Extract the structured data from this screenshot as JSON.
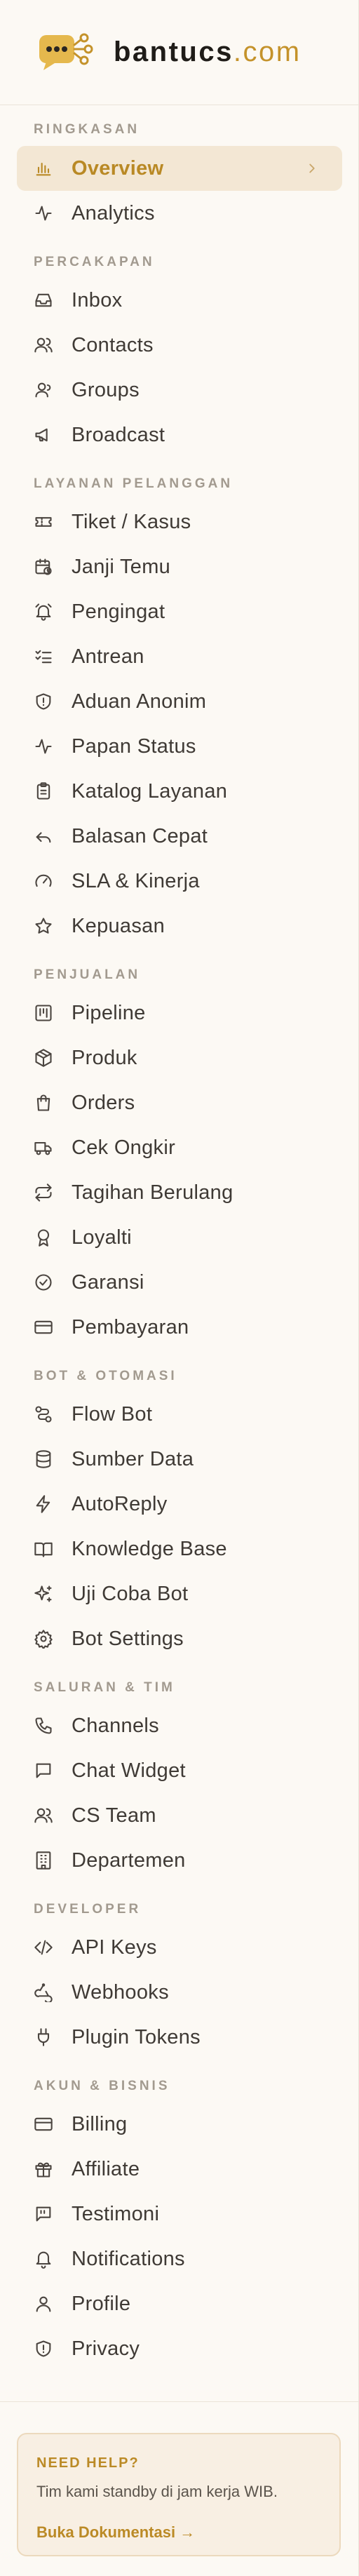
{
  "brand": {
    "name": "bantucs",
    "tld": ".com"
  },
  "sections": {
    "ringkasan": "RINGKASAN",
    "percakapan": "PERCAKAPAN",
    "layanan": "LAYANAN PELANGGAN",
    "penjualan": "PENJUALAN",
    "bot": "BOT & OTOMASI",
    "saluran": "SALURAN & TIM",
    "developer": "DEVELOPER",
    "akun": "AKUN & BISNIS"
  },
  "nav": {
    "overview": "Overview",
    "analytics": "Analytics",
    "inbox": "Inbox",
    "contacts": "Contacts",
    "groups": "Groups",
    "broadcast": "Broadcast",
    "tiket": "Tiket / Kasus",
    "janji": "Janji Temu",
    "pengingat": "Pengingat",
    "antrean": "Antrean",
    "aduan": "Aduan Anonim",
    "papan": "Papan Status",
    "katalog": "Katalog Layanan",
    "balasan": "Balasan Cepat",
    "sla": "SLA & Kinerja",
    "kepuasan": "Kepuasan",
    "pipeline": "Pipeline",
    "produk": "Produk",
    "orders": "Orders",
    "ongkir": "Cek Ongkir",
    "tagihan": "Tagihan Berulang",
    "loyalti": "Loyalti",
    "garansi": "Garansi",
    "pembayaran": "Pembayaran",
    "flowbot": "Flow Bot",
    "sumberdata": "Sumber Data",
    "autoreply": "AutoReply",
    "kb": "Knowledge Base",
    "ujicoba": "Uji Coba Bot",
    "botsettings": "Bot Settings",
    "channels": "Channels",
    "chatwidget": "Chat Widget",
    "csteam": "CS Team",
    "departemen": "Departemen",
    "apikeys": "API Keys",
    "webhooks": "Webhooks",
    "plugintokens": "Plugin Tokens",
    "billing": "Billing",
    "affiliate": "Affiliate",
    "testimoni": "Testimoni",
    "notifications": "Notifications",
    "profile": "Profile",
    "privacy": "Privacy"
  },
  "help": {
    "title": "NEED HELP?",
    "desc": "Tim kami standby di jam kerja WIB.",
    "link": "Buka Dokumentasi →"
  },
  "colors": {
    "accent": "#c4922a",
    "active_bg": "#f3e7d4",
    "background": "#fbf8f3"
  }
}
